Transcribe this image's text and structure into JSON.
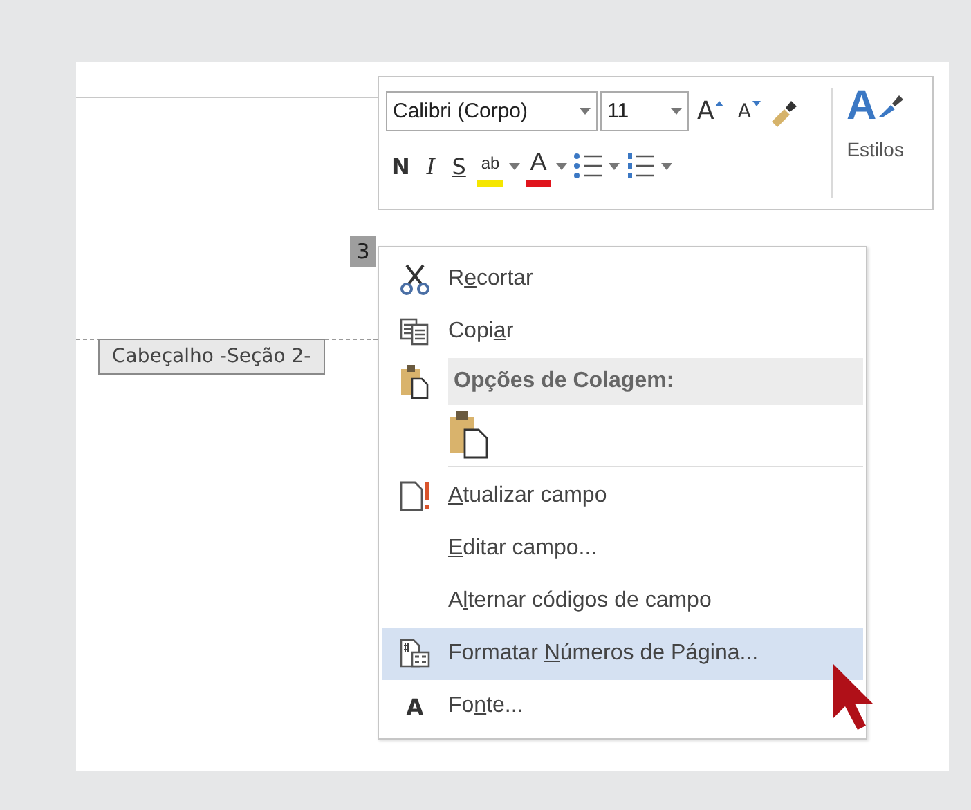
{
  "toolbar": {
    "font_name": "Calibri (Corpo)",
    "font_size": "11",
    "grow_font": "A",
    "shrink_font": "A",
    "bold": "N",
    "italic": "I",
    "underline": "S",
    "highlight": "ab",
    "font_color": "A",
    "styles_glyph": "A",
    "styles_label": "Estilos"
  },
  "page_number": "3",
  "header_label": "Cabeçalho -Seção 2-",
  "menu": [
    {
      "kind": "item",
      "pre": "R",
      "key": "e",
      "post": "cortar",
      "selected": false
    },
    {
      "kind": "item",
      "pre": "Copi",
      "key": "a",
      "post": "r",
      "selected": false
    },
    {
      "kind": "header",
      "text": "Opções de Colagem:"
    },
    {
      "kind": "paste-options"
    },
    {
      "kind": "separator"
    },
    {
      "kind": "item",
      "key": "A",
      "post": "tualizar campo",
      "selected": false
    },
    {
      "kind": "item",
      "key": "E",
      "post": "ditar campo...",
      "selected": false
    },
    {
      "kind": "item",
      "pre": "A",
      "key": "l",
      "post": "ternar códigos de campo",
      "selected": false
    },
    {
      "kind": "item",
      "pre": "Formatar ",
      "key": "N",
      "post": "úmeros de Página...",
      "selected": true
    },
    {
      "kind": "item",
      "icon_text": "A",
      "pre": "Fo",
      "key": "n",
      "post": "te...",
      "selected": false
    }
  ]
}
